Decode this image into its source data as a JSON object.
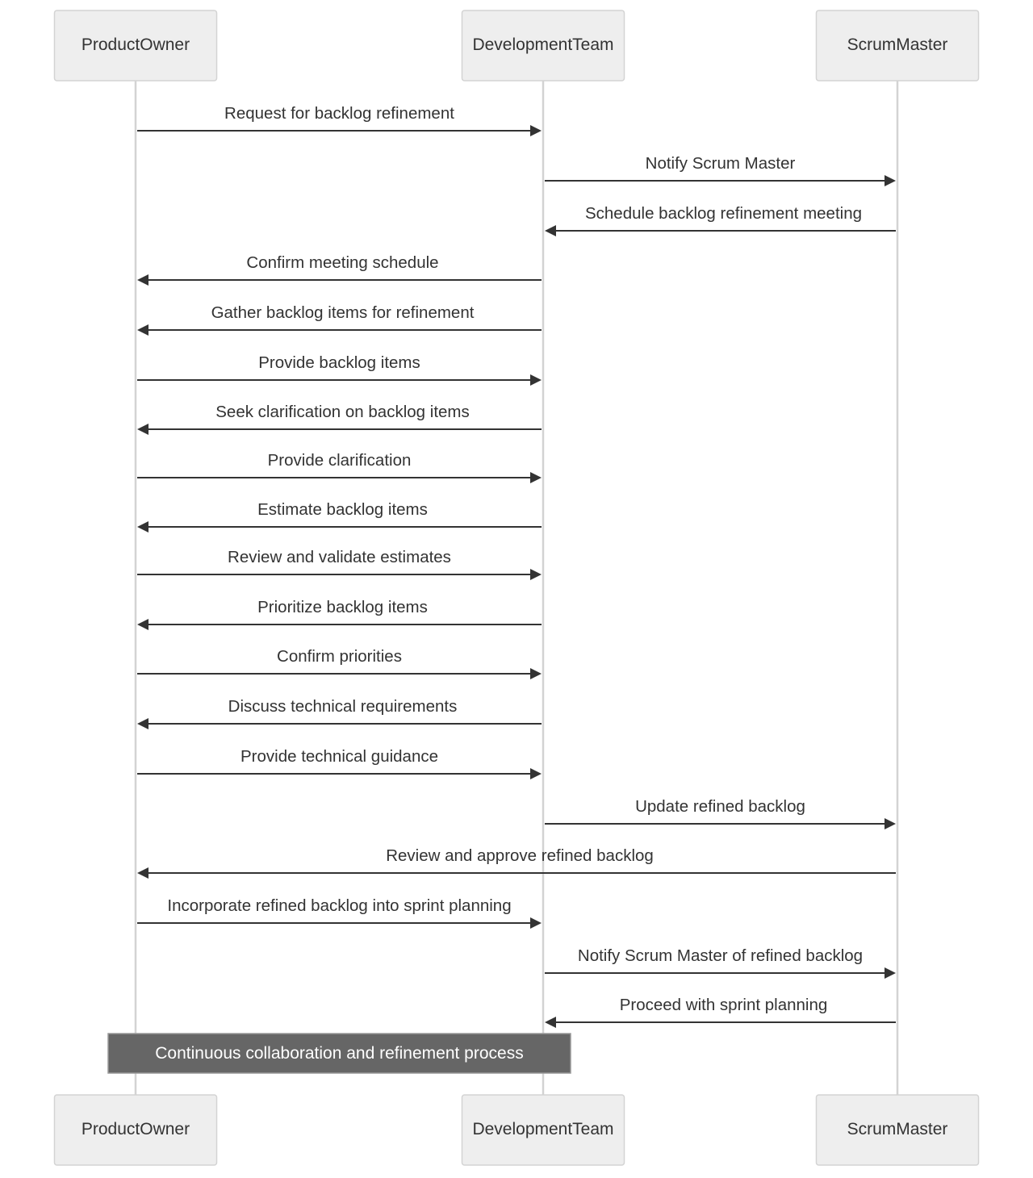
{
  "diagram": {
    "type": "sequence",
    "participants": [
      {
        "id": "po",
        "label": "ProductOwner"
      },
      {
        "id": "dt",
        "label": "DevelopmentTeam"
      },
      {
        "id": "sm",
        "label": "ScrumMaster"
      }
    ],
    "messages": [
      {
        "from": "po",
        "to": "dt",
        "label": "Request for backlog refinement"
      },
      {
        "from": "dt",
        "to": "sm",
        "label": "Notify Scrum Master"
      },
      {
        "from": "sm",
        "to": "dt",
        "label": "Schedule backlog refinement meeting"
      },
      {
        "from": "dt",
        "to": "po",
        "label": "Confirm meeting schedule"
      },
      {
        "from": "dt",
        "to": "po",
        "label": "Gather backlog items for refinement"
      },
      {
        "from": "po",
        "to": "dt",
        "label": "Provide backlog items"
      },
      {
        "from": "dt",
        "to": "po",
        "label": "Seek clarification on backlog items"
      },
      {
        "from": "po",
        "to": "dt",
        "label": "Provide clarification"
      },
      {
        "from": "dt",
        "to": "po",
        "label": "Estimate backlog items"
      },
      {
        "from": "po",
        "to": "dt",
        "label": "Review and validate estimates"
      },
      {
        "from": "dt",
        "to": "po",
        "label": "Prioritize backlog items"
      },
      {
        "from": "po",
        "to": "dt",
        "label": "Confirm priorities"
      },
      {
        "from": "dt",
        "to": "po",
        "label": "Discuss technical requirements"
      },
      {
        "from": "po",
        "to": "dt",
        "label": "Provide technical guidance"
      },
      {
        "from": "dt",
        "to": "sm",
        "label": "Update refined backlog"
      },
      {
        "from": "sm",
        "to": "po",
        "label": "Review and approve refined backlog"
      },
      {
        "from": "po",
        "to": "dt",
        "label": "Incorporate refined backlog into sprint planning"
      },
      {
        "from": "dt",
        "to": "sm",
        "label": "Notify Scrum Master of refined backlog"
      },
      {
        "from": "sm",
        "to": "dt",
        "label": "Proceed with sprint planning"
      }
    ],
    "note": {
      "over": [
        "po",
        "dt"
      ],
      "label": "Continuous collaboration and refinement process"
    }
  }
}
